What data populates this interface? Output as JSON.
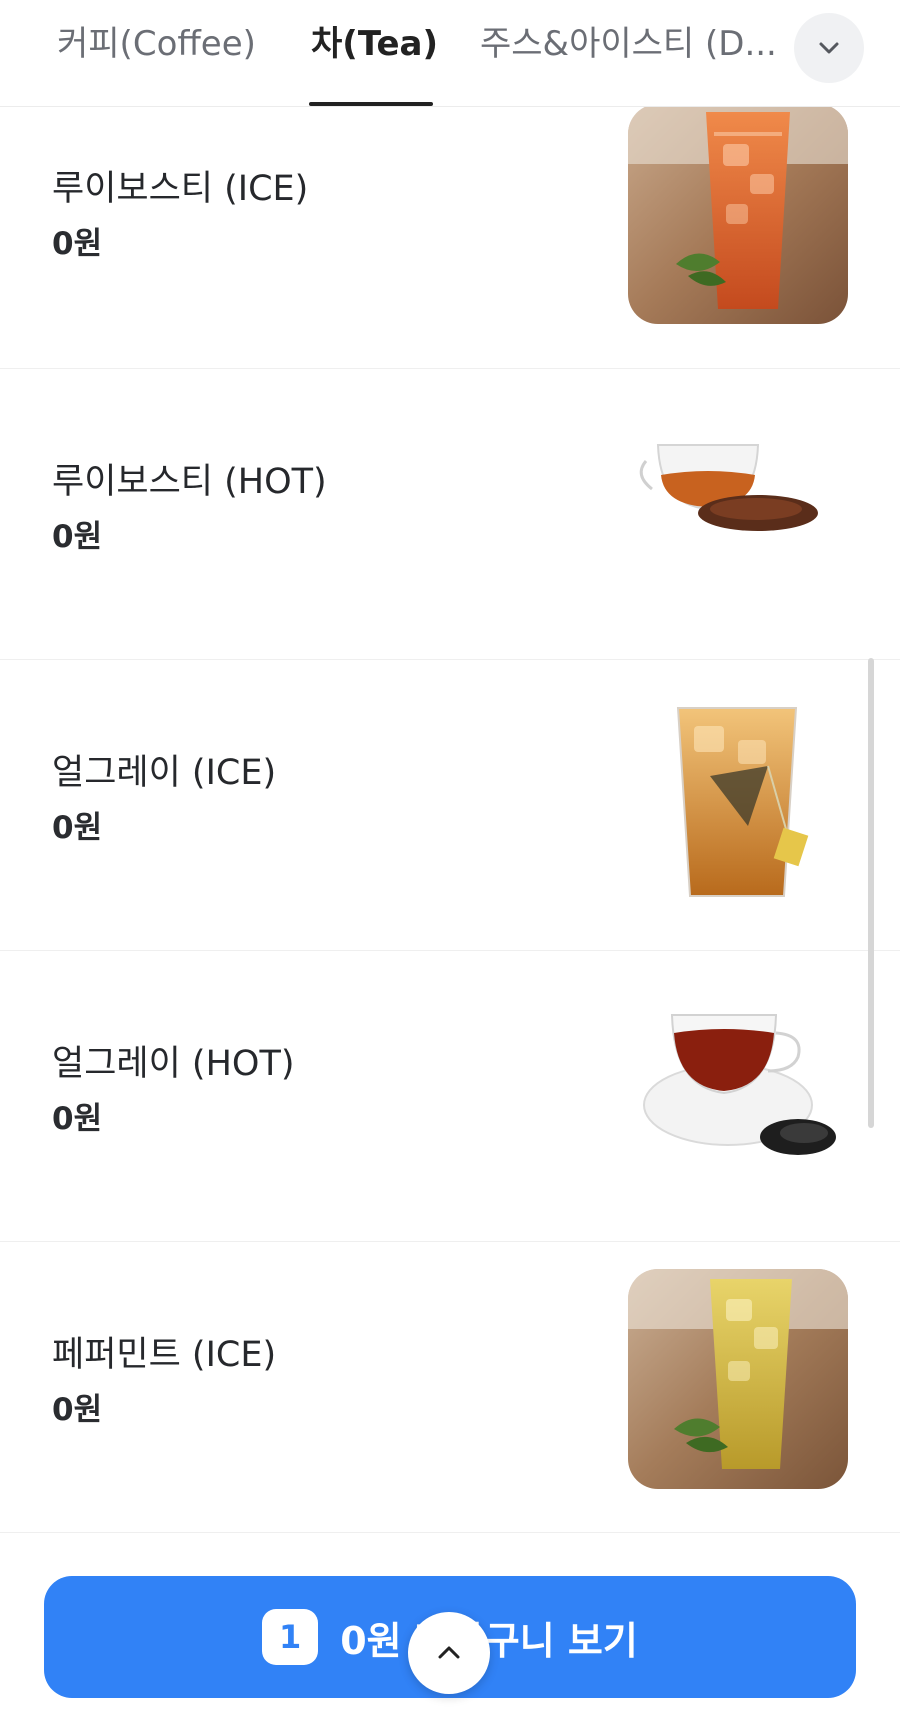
{
  "tabs": [
    {
      "label": "커피(Coffee)",
      "active": false
    },
    {
      "label": "차(Tea)",
      "active": true
    },
    {
      "label": "주스&아이스티 (D...",
      "active": false
    }
  ],
  "tab_more_icon": "chevron-down-icon",
  "items": [
    {
      "name": "루이보스티 (ICE)",
      "price": "0원",
      "image": "iced-rooibos-tea"
    },
    {
      "name": "루이보스티 (HOT)",
      "price": "0원",
      "image": "hot-rooibos-tea"
    },
    {
      "name": "얼그레이 (ICE)",
      "price": "0원",
      "image": "iced-earl-grey"
    },
    {
      "name": "얼그레이 (HOT)",
      "price": "0원",
      "image": "hot-earl-grey"
    },
    {
      "name": "페퍼민트 (ICE)",
      "price": "0원",
      "image": "iced-peppermint"
    }
  ],
  "cart": {
    "count": "1",
    "label": "0원 장바구니 보기",
    "color": "#3182f6"
  },
  "scroll_top_icon": "chevron-up-icon"
}
